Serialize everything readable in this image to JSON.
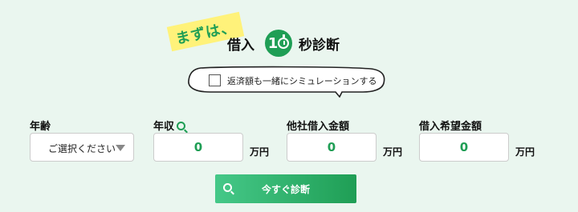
{
  "header": {
    "badge": "まずは、",
    "title_prefix": "借入",
    "timer_number": "1",
    "title_suffix": "秒診断"
  },
  "repayment_option": {
    "label": "返済額も一緒にシミュレーションする",
    "checked": false
  },
  "fields": {
    "age": {
      "label": "年齢",
      "selected": "ご選択ください"
    },
    "income": {
      "label": "年収",
      "value": "0",
      "unit": "万円"
    },
    "other_loans": {
      "label": "他社借入金額",
      "value": "0",
      "unit": "万円"
    },
    "desired_amount": {
      "label": "借入希望金額",
      "value": "0",
      "unit": "万円"
    }
  },
  "submit": {
    "label": "今すぐ診断"
  },
  "colors": {
    "accent": "#1f9e55",
    "background": "#eaf6ef",
    "badge": "#fff27a"
  },
  "icons": {
    "timer": "stopwatch-icon",
    "search": "search-icon",
    "dropdown": "chevron-down-icon"
  }
}
